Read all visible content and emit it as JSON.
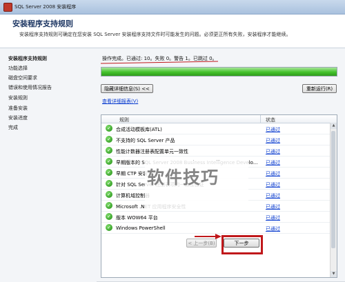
{
  "window": {
    "title": "SQL Server 2008 安装程序"
  },
  "header": {
    "title": "安装程序支持规则",
    "description": "安装程序支持规则可确定在您安装 SQL Server 安装程序支持文件时可能发生的问题。必须更正所有失败，安装程序才能继续。"
  },
  "sidebar": {
    "items": [
      {
        "label": "安装程序支持规则",
        "active": true
      },
      {
        "label": "功能选择",
        "active": false
      },
      {
        "label": "磁盘空间要求",
        "active": false
      },
      {
        "label": "错误和使用情况报告",
        "active": false
      },
      {
        "label": "安装规则",
        "active": false
      },
      {
        "label": "准备安装",
        "active": false
      },
      {
        "label": "安装进度",
        "active": false
      },
      {
        "label": "完成",
        "active": false
      }
    ]
  },
  "main": {
    "status_text": "操作完成。已通过: 10。失败 0。警告 1。已跳过 0。",
    "progress_percent": 100,
    "hide_details_button": "隐藏详细信息(S) <<",
    "rerun_button": "重新运行(R)",
    "view_report_link": "查看详细报表(V)",
    "table": {
      "columns": [
        "规则",
        "状态"
      ],
      "rows": [
        {
          "rule": "合成活动模板库(ATL)",
          "status": "已通过"
        },
        {
          "rule": "不支持的 SQL Server 产品",
          "status": "已通过"
        },
        {
          "rule": "性能计数器注册表配置单元一致性",
          "status": "已通过"
        },
        {
          "rule": "早期版本的 SQL Server 2008 Business Intelligence Develo...",
          "status": "已通过"
        },
        {
          "rule": "早期 CTP 安装",
          "status": "已通过"
        },
        {
          "rule": "针对 SQL Server 注册表项的一致性验证",
          "status": "已通过"
        },
        {
          "rule": "计算机域控制器",
          "status": "已通过"
        },
        {
          "rule": "Microsoft .NET 应用程序安全性",
          "status": "已通过"
        },
        {
          "rule": "版本 WOW64 平台",
          "status": "已通过"
        },
        {
          "rule": "Windows PowerShell",
          "status": "已通过"
        }
      ]
    }
  },
  "footer": {
    "back_button": "< 上一步(B)",
    "next_button": "下一步"
  },
  "watermark": "软件技巧",
  "colors": {
    "accent_red": "#c0181b",
    "progress_green": "#43c22b",
    "link_blue": "#0a3ccf"
  }
}
